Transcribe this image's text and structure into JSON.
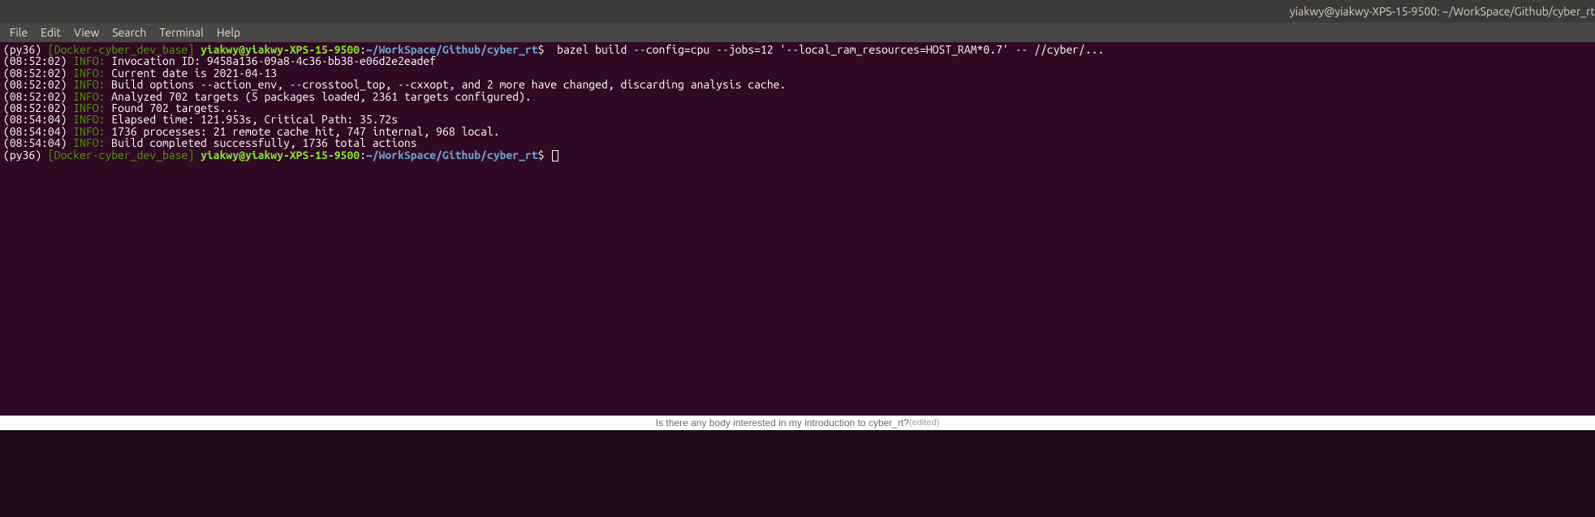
{
  "window": {
    "title": "yiakwy@yiakwy-XPS-15-9500: ~/WorkSpace/Github/cyber_rt"
  },
  "menu": [
    "File",
    "Edit",
    "View",
    "Search",
    "Terminal",
    "Help"
  ],
  "prompt": {
    "venv": "(py36)",
    "docker": "[Docker-cyber_dev_base]",
    "userhost": "yiakwy@yiakwy-XPS-15-9500",
    "colon": ":",
    "path": "~/WorkSpace/Github/cyber_rt",
    "dollar": "$"
  },
  "command": "  bazel build --config=cpu --jobs=12 '--local_ram_resources=HOST_RAM*0.7' -- //cyber/...",
  "lines": [
    {
      "ts": "(08:52:02)",
      "tag": "INFO:",
      "msg": "Invocation ID: 9458a136-09a8-4c36-bb38-e06d2e2eadef"
    },
    {
      "ts": "(08:52:02)",
      "tag": "INFO:",
      "msg": "Current date is 2021-04-13"
    },
    {
      "ts": "(08:52:02)",
      "tag": "INFO:",
      "msg": "Build options --action_env, --crosstool_top, --cxxopt, and 2 more have changed, discarding analysis cache."
    },
    {
      "ts": "(08:52:02)",
      "tag": "INFO:",
      "msg": "Analyzed 702 targets (5 packages loaded, 2361 targets configured)."
    },
    {
      "ts": "(08:52:02)",
      "tag": "INFO:",
      "msg": "Found 702 targets..."
    },
    {
      "ts": "(08:54:04)",
      "tag": "INFO:",
      "msg": "Elapsed time: 121.953s, Critical Path: 35.72s"
    },
    {
      "ts": "(08:54:04)",
      "tag": "INFO:",
      "msg": "1736 processes: 21 remote cache hit, 747 internal, 968 local."
    },
    {
      "ts": "(08:54:04)",
      "tag": "INFO:",
      "msg": "Build completed successfully, 1736 total actions"
    }
  ],
  "bottom": {
    "text": "Is there any body interested in my introduction to cyber_rt?",
    "edited": "(edited)"
  }
}
